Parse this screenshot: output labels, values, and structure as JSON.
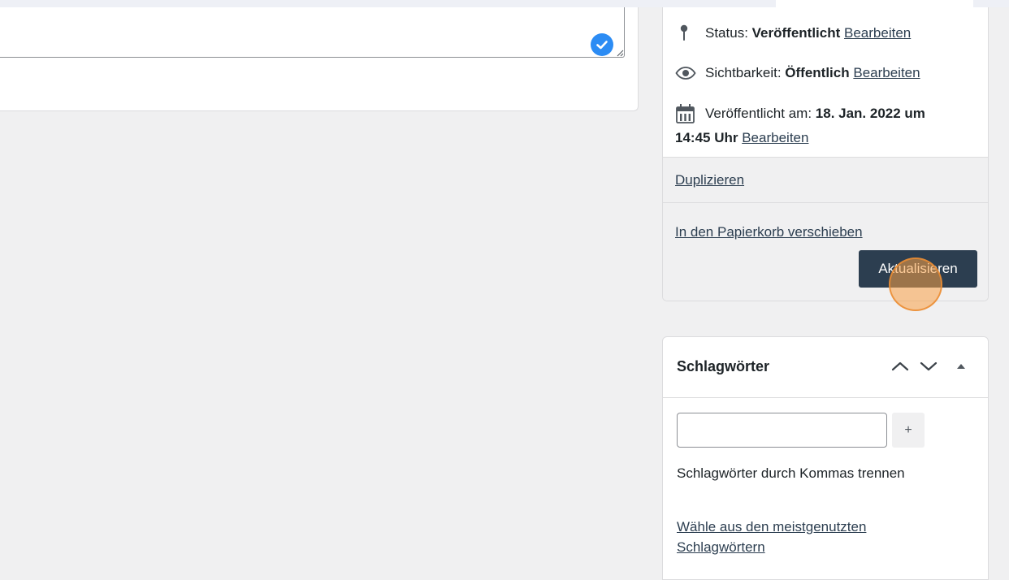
{
  "publish": {
    "status_label": "Status:",
    "status_value": "Veröffentlicht",
    "visibility_label": "Sichtbarkeit:",
    "visibility_value": "Öffentlich",
    "published_label": "Veröffentlicht am:",
    "published_date": "18. Jan. 2022 um",
    "published_time": "14:45 Uhr",
    "edit_link": "Bearbeiten",
    "duplicate_link": "Duplizieren",
    "trash_link": "In den Papierkorb verschieben",
    "update_button": "Aktualisieren"
  },
  "tags": {
    "title": "Schlagwörter",
    "input_value": "",
    "add_button": "+",
    "hint": "Schlagwörter durch Kommas trennen",
    "most_used_link": "Wähle aus den meistgenutzten Schlagwörtern"
  },
  "icons": {
    "status": "pin-icon",
    "visibility": "eye-icon",
    "published": "calendar-icon",
    "check": "check-circle-icon",
    "move_up": "chevron-up-icon",
    "move_down": "chevron-down-icon",
    "toggle": "triangle-up-icon"
  },
  "colors": {
    "accent": "#2c3e50",
    "check_badge": "#2c8cf4",
    "click_marker": "#faa046"
  }
}
